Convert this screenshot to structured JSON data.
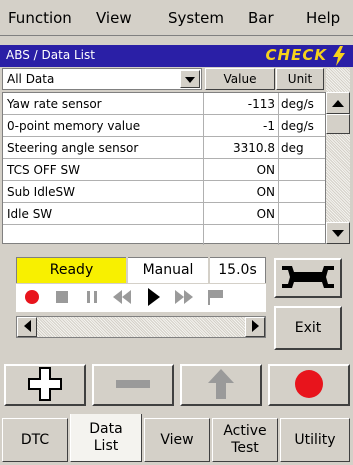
{
  "menu": {
    "items": [
      "Function",
      "View",
      "System",
      "Bar",
      "Help"
    ]
  },
  "titlebar": {
    "title": "ABS / Data List",
    "badge": "CHECK"
  },
  "header": {
    "filter_value": "All Data",
    "value_label": "Value",
    "unit_label": "Unit"
  },
  "table": {
    "rows": [
      {
        "name": "Yaw rate sensor",
        "value": "-113",
        "unit": "deg/s"
      },
      {
        "name": "0-point memory value",
        "value": "-1",
        "unit": "deg/s"
      },
      {
        "name": "Steering angle sensor",
        "value": "3310.8",
        "unit": "deg"
      },
      {
        "name": "TCS OFF SW",
        "value": "ON",
        "unit": ""
      },
      {
        "name": "Sub IdleSW",
        "value": "ON",
        "unit": ""
      },
      {
        "name": "Idle SW",
        "value": "ON",
        "unit": ""
      }
    ]
  },
  "control": {
    "status": "Ready",
    "mode": "Manual",
    "interval": "15.0s",
    "exit_label": "Exit"
  },
  "tabs": [
    {
      "label": "DTC"
    },
    {
      "label": "Data\nList"
    },
    {
      "label": "View"
    },
    {
      "label": "Active\nTest"
    },
    {
      "label": "Utility"
    }
  ],
  "colors": {
    "titlebar_bg": "#2a1fa6",
    "check_color": "#f6d21c",
    "ready_bg": "#f8f000",
    "record_red": "#e8141c"
  }
}
